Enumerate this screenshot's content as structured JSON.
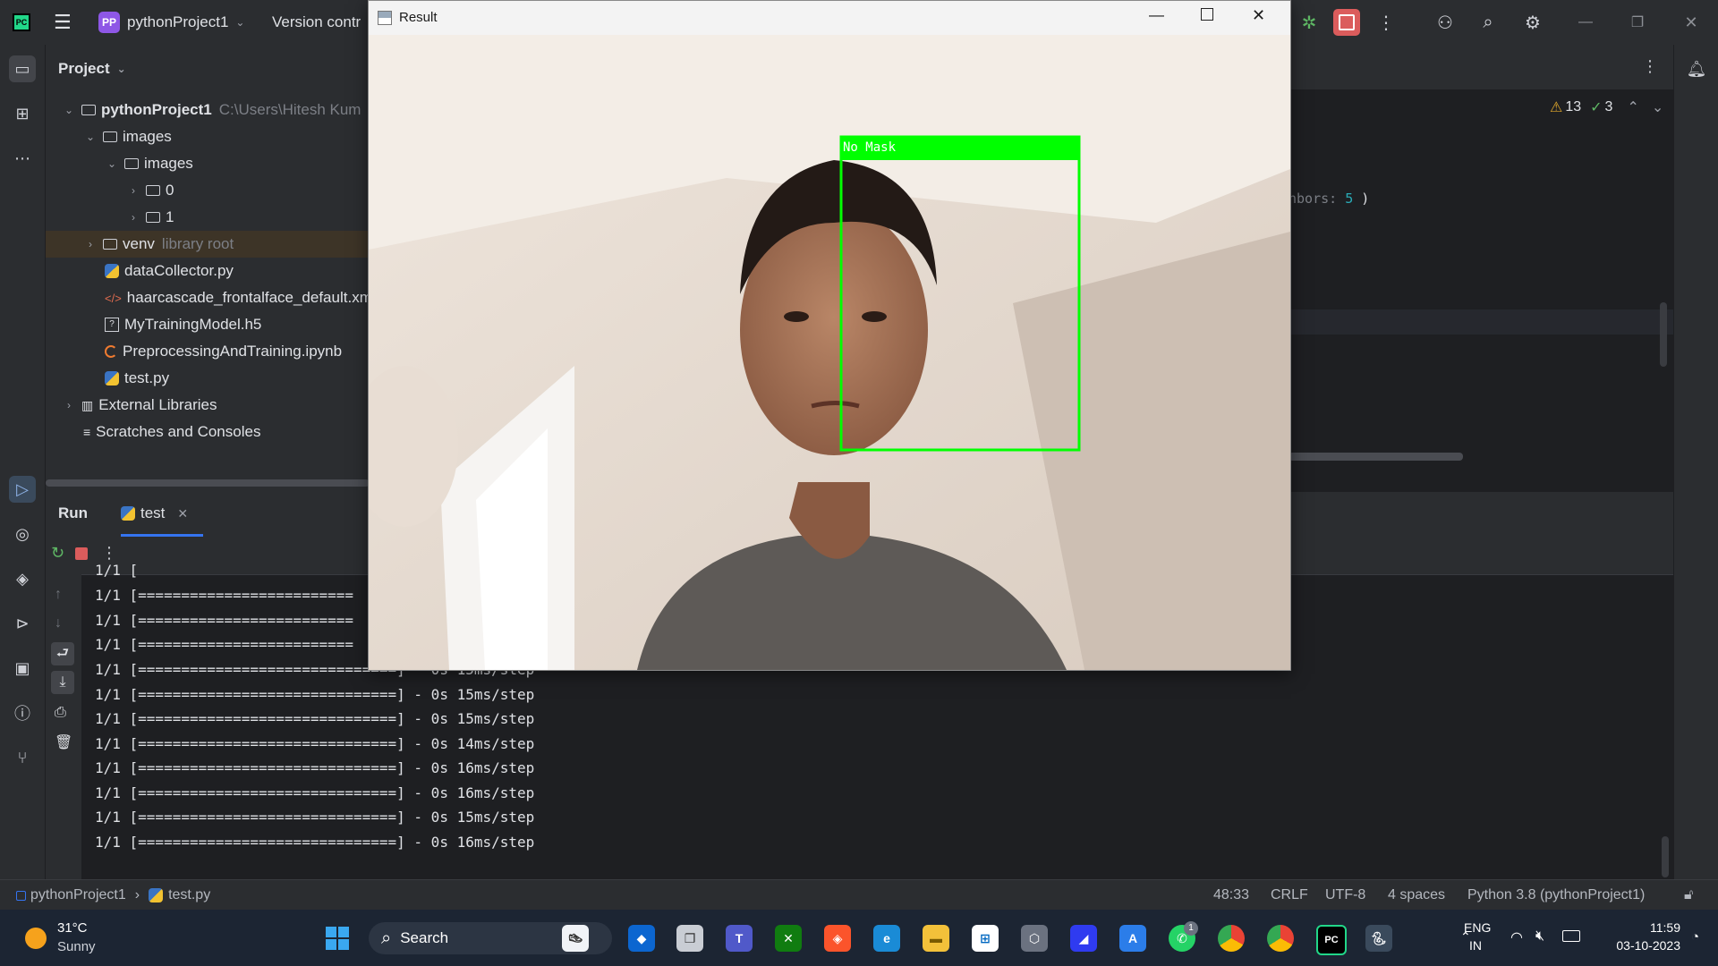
{
  "titlebar": {
    "project_badge": "PP",
    "project_name": "pythonProject1",
    "version_control": "Version contr"
  },
  "project_panel": {
    "title": "Project",
    "tree": [
      {
        "label": "pythonProject1",
        "hint": "C:\\Users\\Hitesh Kum"
      },
      {
        "label": "images"
      },
      {
        "label": "images"
      },
      {
        "label": "0"
      },
      {
        "label": "1"
      },
      {
        "label": "venv",
        "hint": "library root"
      },
      {
        "label": "dataCollector.py"
      },
      {
        "label": "haarcascade_frontalface_default.xm"
      },
      {
        "label": "MyTrainingModel.h5"
      },
      {
        "label": "PreprocessingAndTraining.ipynb"
      },
      {
        "label": "test.py"
      },
      {
        "label": "External Libraries"
      },
      {
        "label": "Scratches and Consoles"
      }
    ]
  },
  "editor": {
    "warnings": "13",
    "checks": "3",
    "code_fragment_label": "hbors:",
    "code_fragment_value": "5",
    "code_fragment_paren": ")"
  },
  "run_panel": {
    "run_label": "Run",
    "tab_label": "test",
    "console_lines": [
      "1/1 [",
      "1/1 [=========================",
      "1/1 [=========================",
      "1/1 [=========================",
      "1/1 [==============================] - 0s 15ms/step",
      "1/1 [==============================] - 0s 15ms/step",
      "1/1 [==============================] - 0s 15ms/step",
      "1/1 [==============================] - 0s 14ms/step",
      "1/1 [==============================] - 0s 16ms/step",
      "1/1 [==============================] - 0s 16ms/step",
      "1/1 [==============================] - 0s 15ms/step",
      "1/1 [==============================] - 0s 16ms/step"
    ]
  },
  "result_window": {
    "title": "Result",
    "detection_label": "No Mask"
  },
  "statusbar": {
    "breadcrumb_project": "pythonProject1",
    "breadcrumb_file": "test.py",
    "position": "48:33",
    "line_sep": "CRLF",
    "encoding": "UTF-8",
    "indent": "4 spaces",
    "interpreter": "Python 3.8 (pythonProject1)"
  },
  "taskbar": {
    "weather_temp": "31°C",
    "weather_desc": "Sunny",
    "search_label": "Search",
    "lang_top": "ENG",
    "lang_bottom": "IN",
    "time": "11:59",
    "date": "03-10-2023",
    "whatsapp_badge": "1"
  },
  "colors": {
    "accent_green": "#00ff00",
    "ide_bg": "#1e1f22",
    "panel_bg": "#2b2d30",
    "stop_red": "#db5c5c"
  }
}
